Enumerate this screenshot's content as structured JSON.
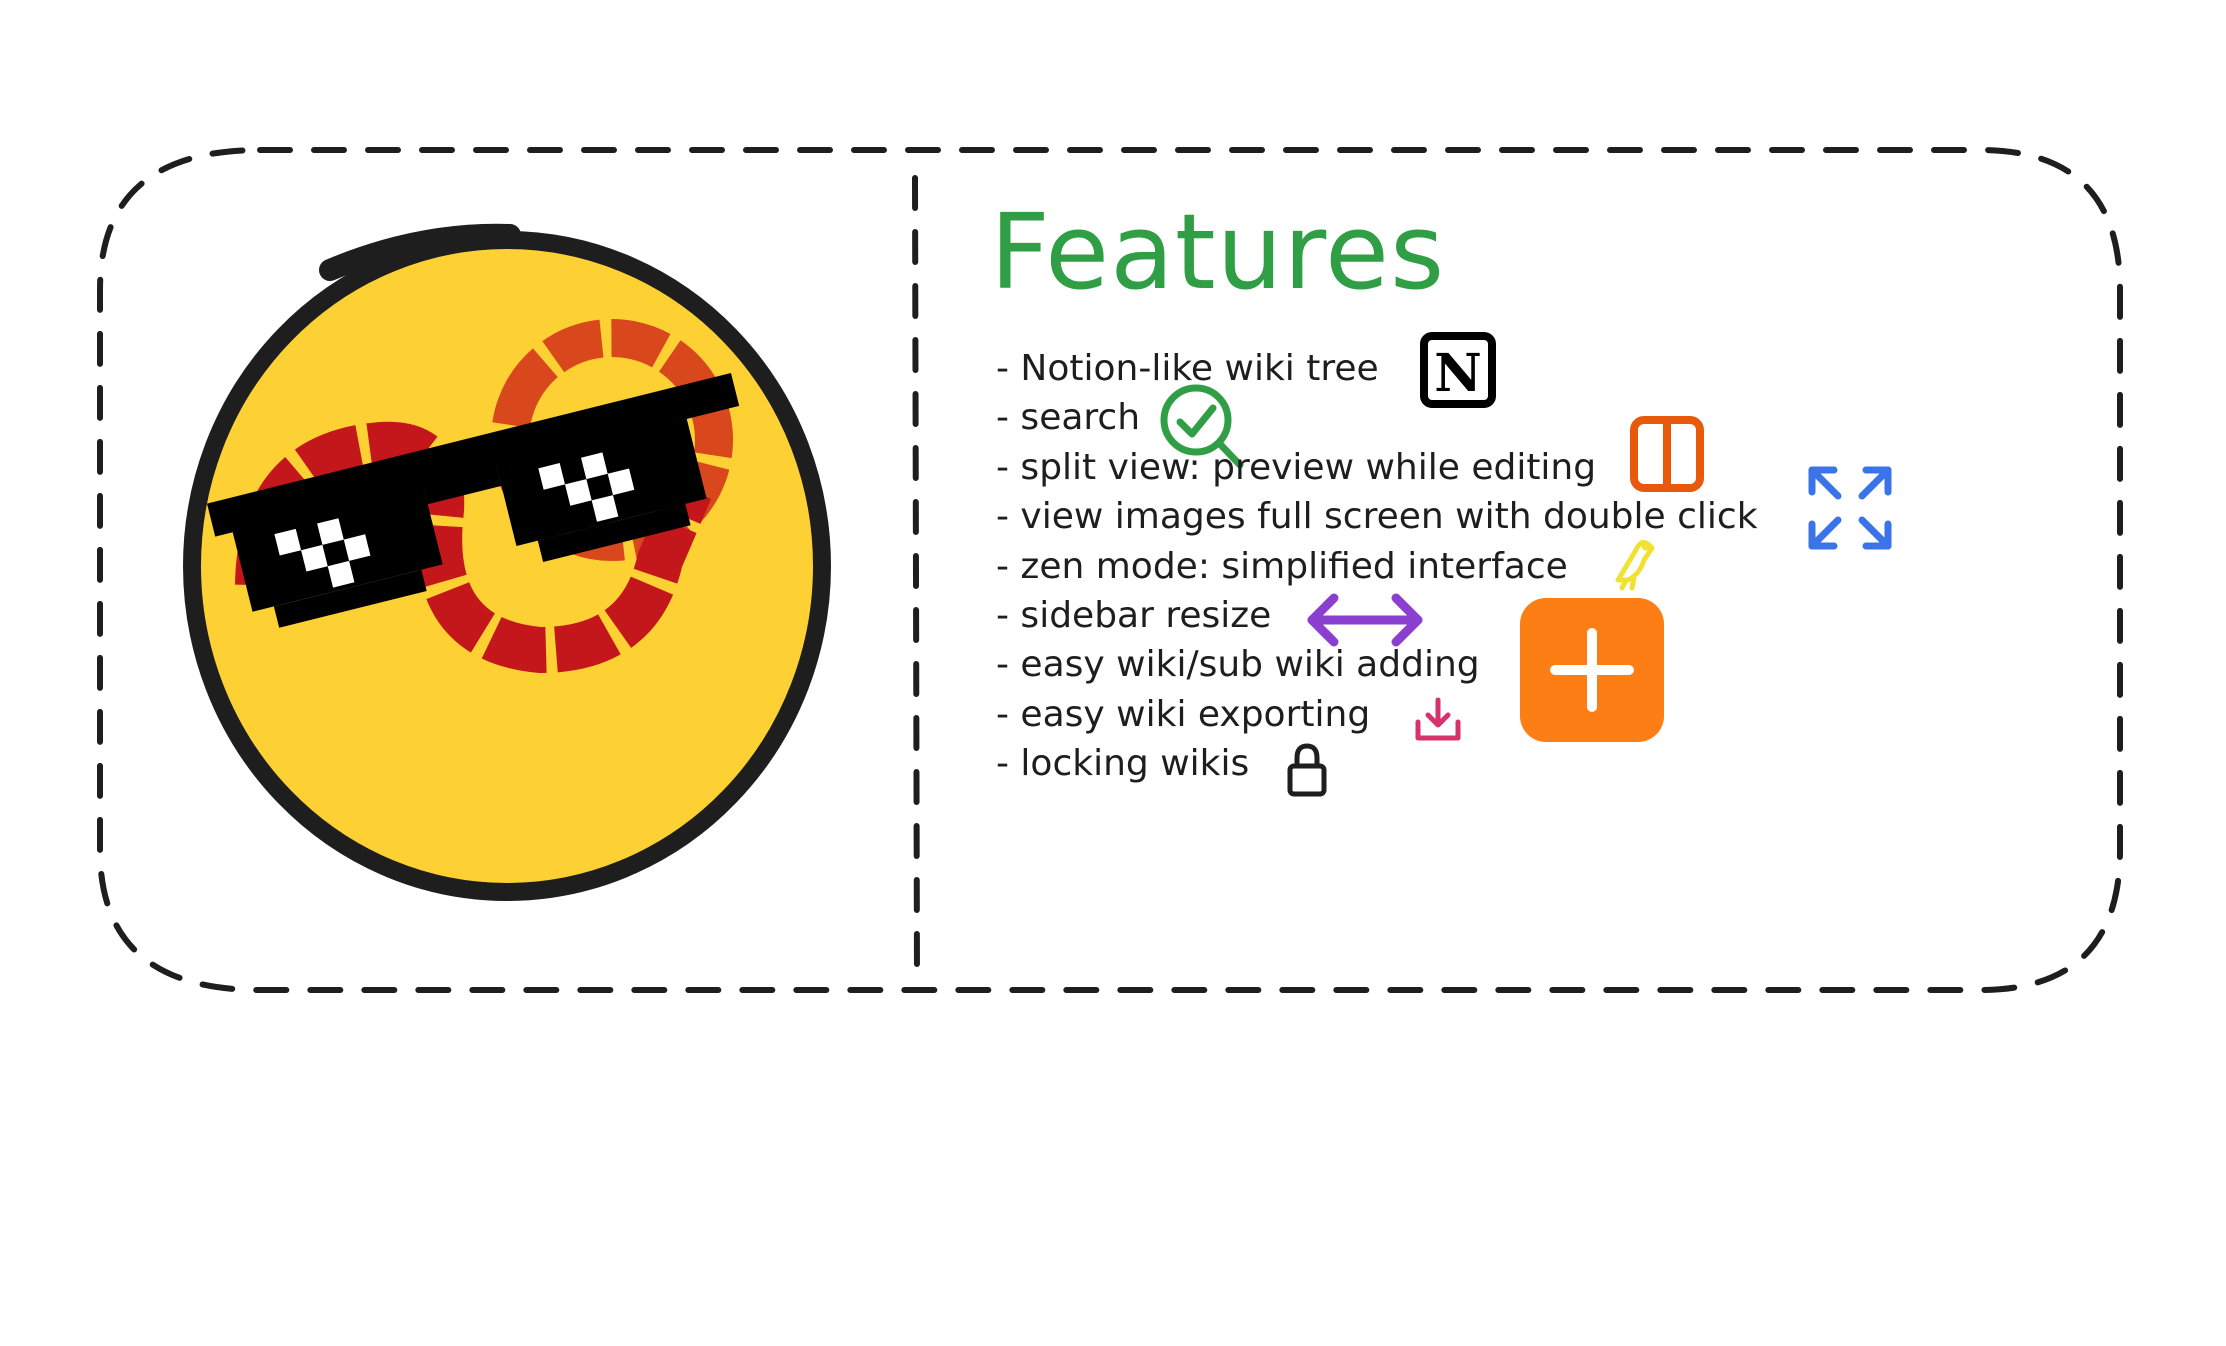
{
  "features": {
    "title": "Features",
    "items": [
      {
        "text": "- Notion-like wiki tree",
        "icon": "notion-icon"
      },
      {
        "text": "- search",
        "icon": "search-check-icon"
      },
      {
        "text": "- split view: preview while editing",
        "icon": "split-view-icon"
      },
      {
        "text": "- view images full screen with double click",
        "icon": "expand-arrows-icon"
      },
      {
        "text": "- zen mode: simplified interface",
        "icon": "bird-icon"
      },
      {
        "text": "- sidebar resize",
        "icon": "double-arrow-icon"
      },
      {
        "text": "- easy wiki/sub wiki adding",
        "icon": "plus-icon"
      },
      {
        "text": "- easy wiki exporting",
        "icon": "download-icon"
      },
      {
        "text": "- locking wikis",
        "icon": "lock-icon"
      }
    ],
    "notion_letter": "N"
  },
  "colors": {
    "title": "#2f9e44",
    "text": "#1e1e1e",
    "border": "#1e1e1e",
    "logo_yellow": "#fdd134",
    "logo_red": "#c4171b",
    "logo_orange": "#d9481c",
    "search": "#2f9e44",
    "split": "#e8590c",
    "expand": "#3b73e8",
    "bird": "#f1e232",
    "arrow": "#8a3fd1",
    "plus_bg": "#fd7e14",
    "download": "#d6336c"
  }
}
